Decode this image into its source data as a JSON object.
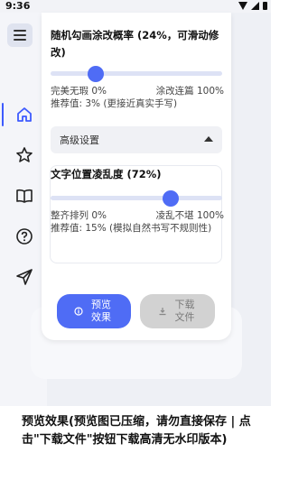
{
  "status_bar": {
    "time": "9:36"
  },
  "stroke_section": {
    "title": "随机勾画涂改概率 (24%，可滑动修改)",
    "value_percent": 24,
    "min_label": "完美无瑕 0%",
    "max_label": "涂改连篇 100%",
    "recommend": "推荐值: 3% (更接近真实手写)"
  },
  "advanced": {
    "label": "高级设置"
  },
  "position_section": {
    "title": "文字位置凌乱度 (72%)",
    "value_percent": 72,
    "min_label": "整齐排列 0%",
    "max_label": "凌乱不堪 100%",
    "recommend": "推荐值: 15% (模拟自然书写不规则性)"
  },
  "buttons": {
    "preview": "预览效果",
    "download": "下载文件"
  },
  "footer": {
    "text": "预览效果(预览图已压缩，请勿直接保存 | 点击\"下载文件\"按钮下载高清无水印版本)"
  },
  "colors": {
    "accent": "#4f6cf5",
    "track": "#dde2f5",
    "disabled": "#d2d2d2"
  },
  "icons": [
    "menu-icon",
    "home-icon",
    "star-icon",
    "book-icon",
    "help-icon",
    "send-icon",
    "info-icon",
    "download-icon"
  ]
}
